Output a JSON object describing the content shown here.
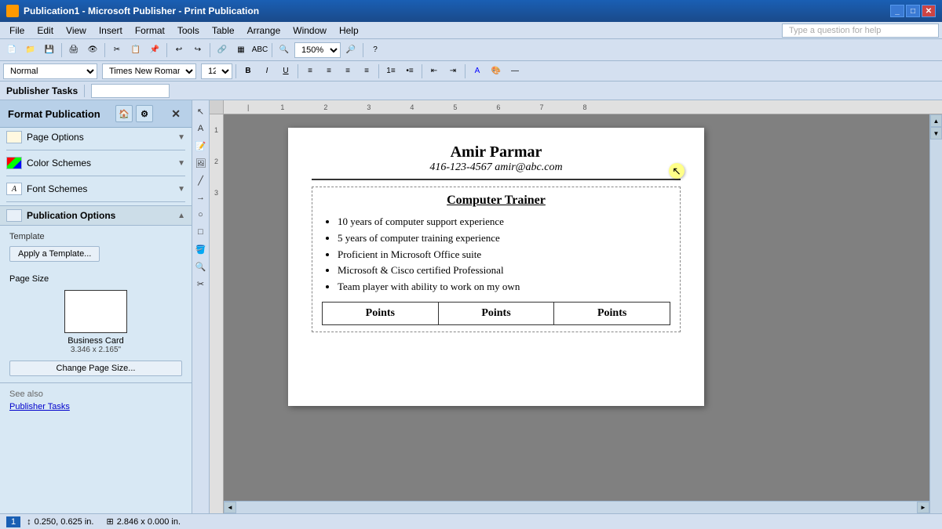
{
  "titlebar": {
    "title": "Publication1 - Microsoft Publisher - Print Publication",
    "icon": "📄",
    "controls": [
      "_",
      "□",
      "✕"
    ]
  },
  "menubar": {
    "items": [
      "File",
      "Edit",
      "View",
      "Insert",
      "Format",
      "Tools",
      "Table",
      "Arrange",
      "Window",
      "Help"
    ],
    "help_placeholder": "Type a question for help"
  },
  "taskbar": {
    "label": "Publisher Tasks"
  },
  "sidebar": {
    "title": "Format Publication",
    "tabs": [
      "home",
      "settings"
    ],
    "sections": {
      "page_options": {
        "label": "Page Options",
        "arrow": "▼"
      },
      "color_schemes": {
        "label": "Color Schemes",
        "arrow": "▼"
      },
      "font_schemes": {
        "label": "Font Schemes",
        "arrow": "▼"
      },
      "publication_options": {
        "label": "Publication Options",
        "arrow": "▲",
        "template_label": "Template",
        "apply_btn": "Apply a Template...",
        "page_size_label": "Page Size",
        "page_size_name": "Business Card",
        "page_size_dims": "3.346 x 2.165\"",
        "change_btn": "Change Page Size..."
      }
    },
    "see_also": {
      "title": "See also",
      "link": "Publisher Tasks"
    }
  },
  "document": {
    "name": "Amir Parmar",
    "contact": "416-123-4567 amir@abc.com",
    "job_title": "Computer Trainer",
    "bullets": [
      "10 years of computer support experience",
      "5 years of computer training experience",
      "Proficient in Microsoft Office suite",
      "Microsoft & Cisco certified Professional",
      "Team player with ability to work on my own"
    ],
    "table_headers": [
      "Points",
      "Points",
      "Points"
    ]
  },
  "statusbar": {
    "page_num": "1",
    "coords1": "0.250, 0.625 in.",
    "coords2": "2.846 x 0.000 in.",
    "coord_icons": [
      "↕",
      "⊞"
    ]
  },
  "zoom": "150%",
  "icons": {
    "cursor": "↖"
  }
}
